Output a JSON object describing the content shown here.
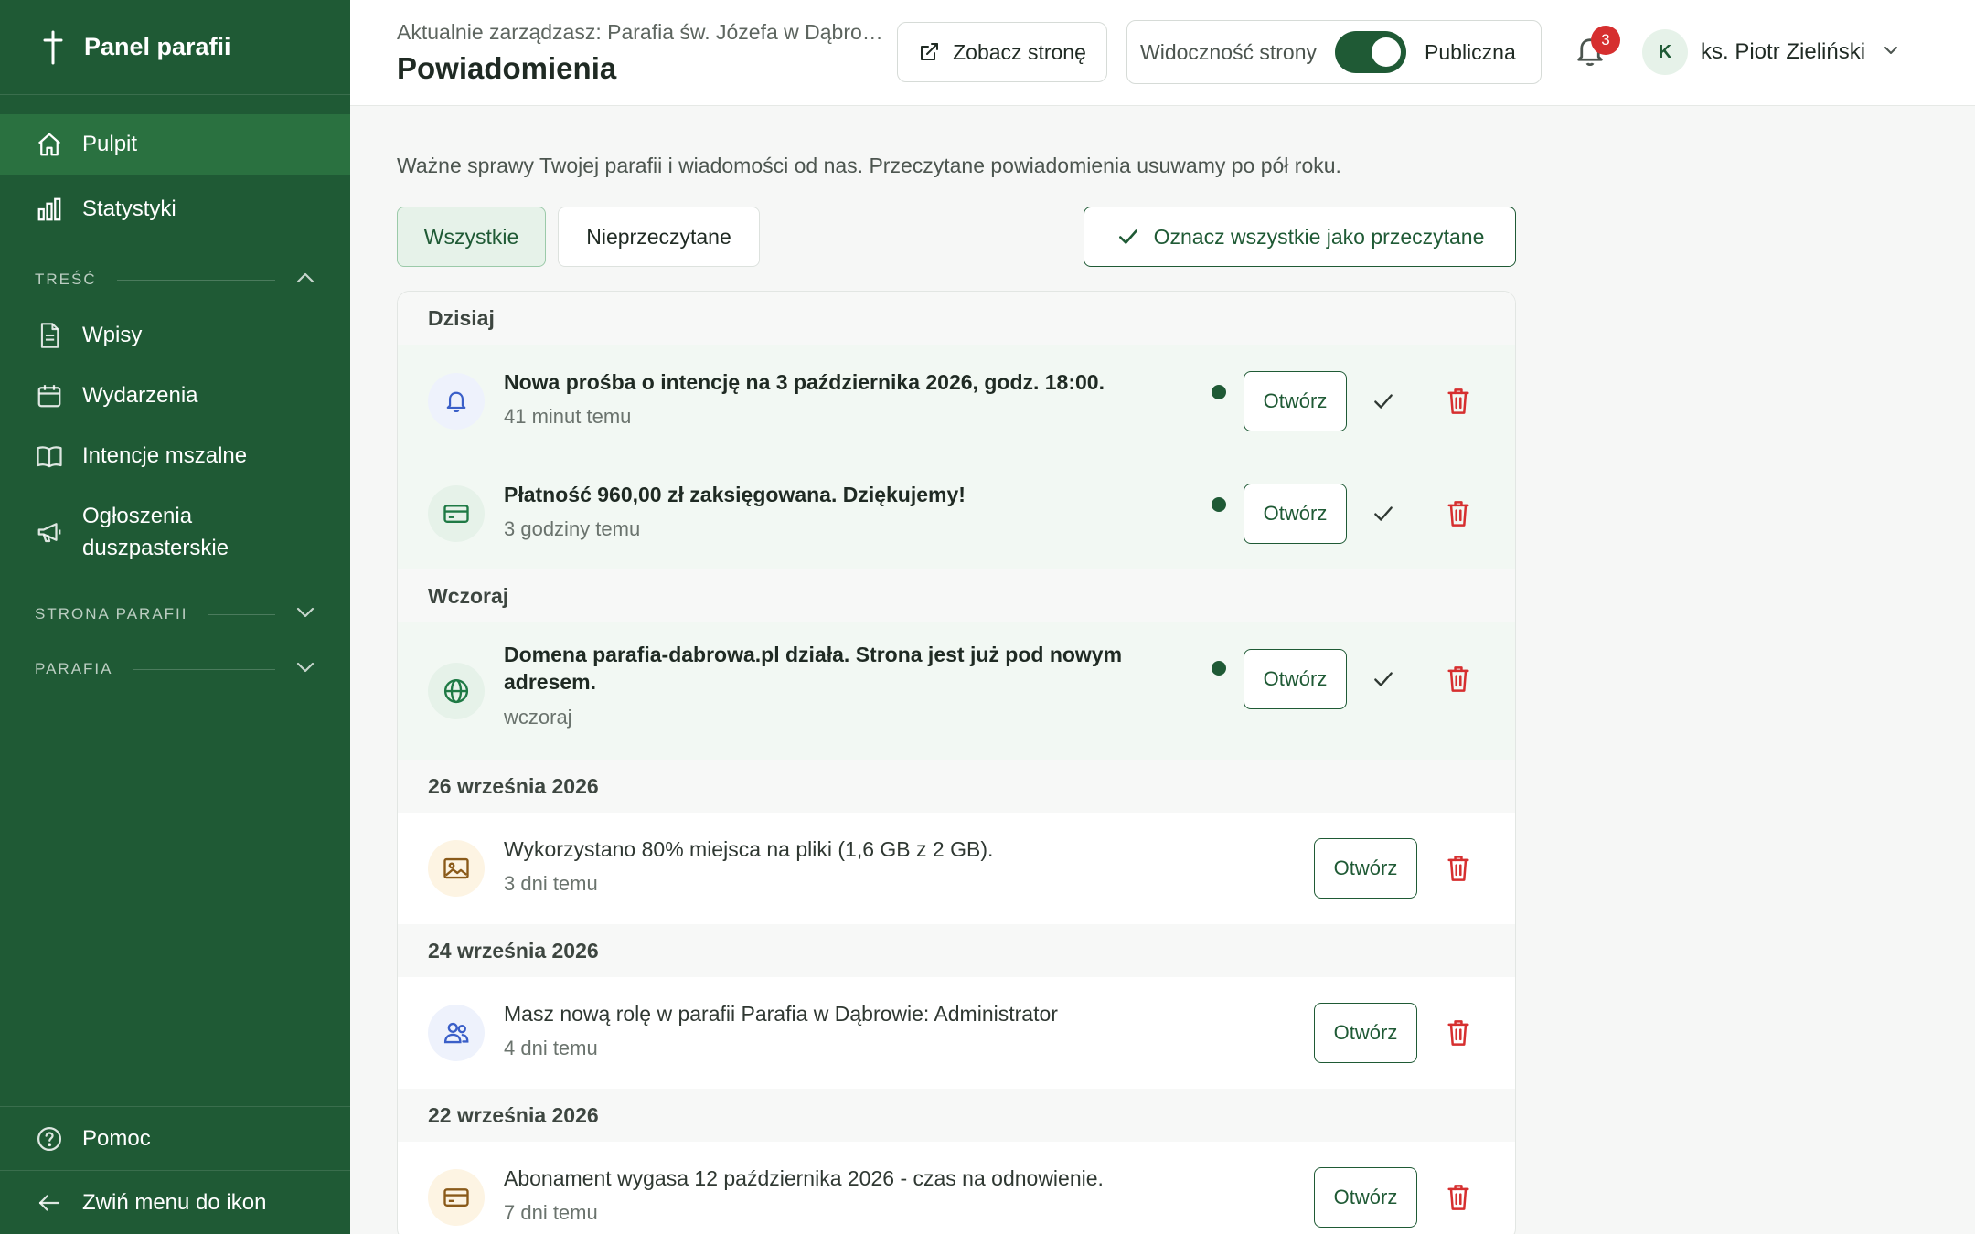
{
  "sidebar": {
    "title": "Panel parafii",
    "items": [
      {
        "label": "Pulpit"
      },
      {
        "label": "Statystyki"
      }
    ],
    "section_content": "TREŚĆ",
    "content_items": [
      {
        "label": "Wpisy"
      },
      {
        "label": "Wydarzenia"
      },
      {
        "label": "Intencje mszalne"
      },
      {
        "label_line1": "Ogłoszenia",
        "label_line2": "duszpasterskie"
      }
    ],
    "section_site": "STRONA PARAFII",
    "section_parish": "PARAFIA",
    "help": "Pomoc",
    "collapse": "Zwiń menu do ikon"
  },
  "header": {
    "crumb": "Aktualnie zarządzasz: Parafia św. Józefa w Dąbrowie",
    "title": "Powiadomienia",
    "view_site": "Zobacz stronę",
    "visibility_label": "Widoczność strony",
    "visibility_value": "Publiczna",
    "bell_count": "3",
    "user_initial": "K",
    "user_name": "ks. Piotr Zieliński"
  },
  "main": {
    "intro": "Ważne sprawy Twojej parafii i wiadomości od nas. Przeczytane powiadomienia usuwamy po pół roku.",
    "tab_all": "Wszystkie",
    "tab_unread": "Nieprzeczytane",
    "mark_all": "Oznacz wszystkie jako przeczytane",
    "open_label": "Otwórz",
    "groups": [
      {
        "label": "Dzisiaj"
      },
      {
        "label": "Wczoraj"
      },
      {
        "label": "26 września 2026"
      },
      {
        "label": "24 września 2026"
      },
      {
        "label": "22 września 2026"
      }
    ],
    "notifications": [
      {
        "title": "Nowa prośba o intencję na 3 października 2026, godz. 18:00.",
        "time": "41 minut temu"
      },
      {
        "title": "Płatność 960,00 zł zaksięgowana. Dziękujemy!",
        "time": "3 godziny temu"
      },
      {
        "title_line1": "Domena parafia-dabrowa.pl działa. Strona jest już pod nowym",
        "title_line2": "adresem.",
        "time": "wczoraj"
      },
      {
        "title": "Wykorzystano 80% miejsca na pliki (1,6 GB z 2 GB).",
        "time": "3 dni temu"
      },
      {
        "title": "Masz nową rolę w parafii Parafia w Dąbrowie: Administrator",
        "time": "4 dni temu"
      },
      {
        "title": "Abonament wygasa 12 października 2026 - czas na odnowienie.",
        "time": "7 dni temu"
      }
    ]
  },
  "colors": {
    "brand": "#1f5a35",
    "danger": "#d62f2f",
    "warning": "#8a5a1a",
    "info": "#3a5fc8"
  }
}
